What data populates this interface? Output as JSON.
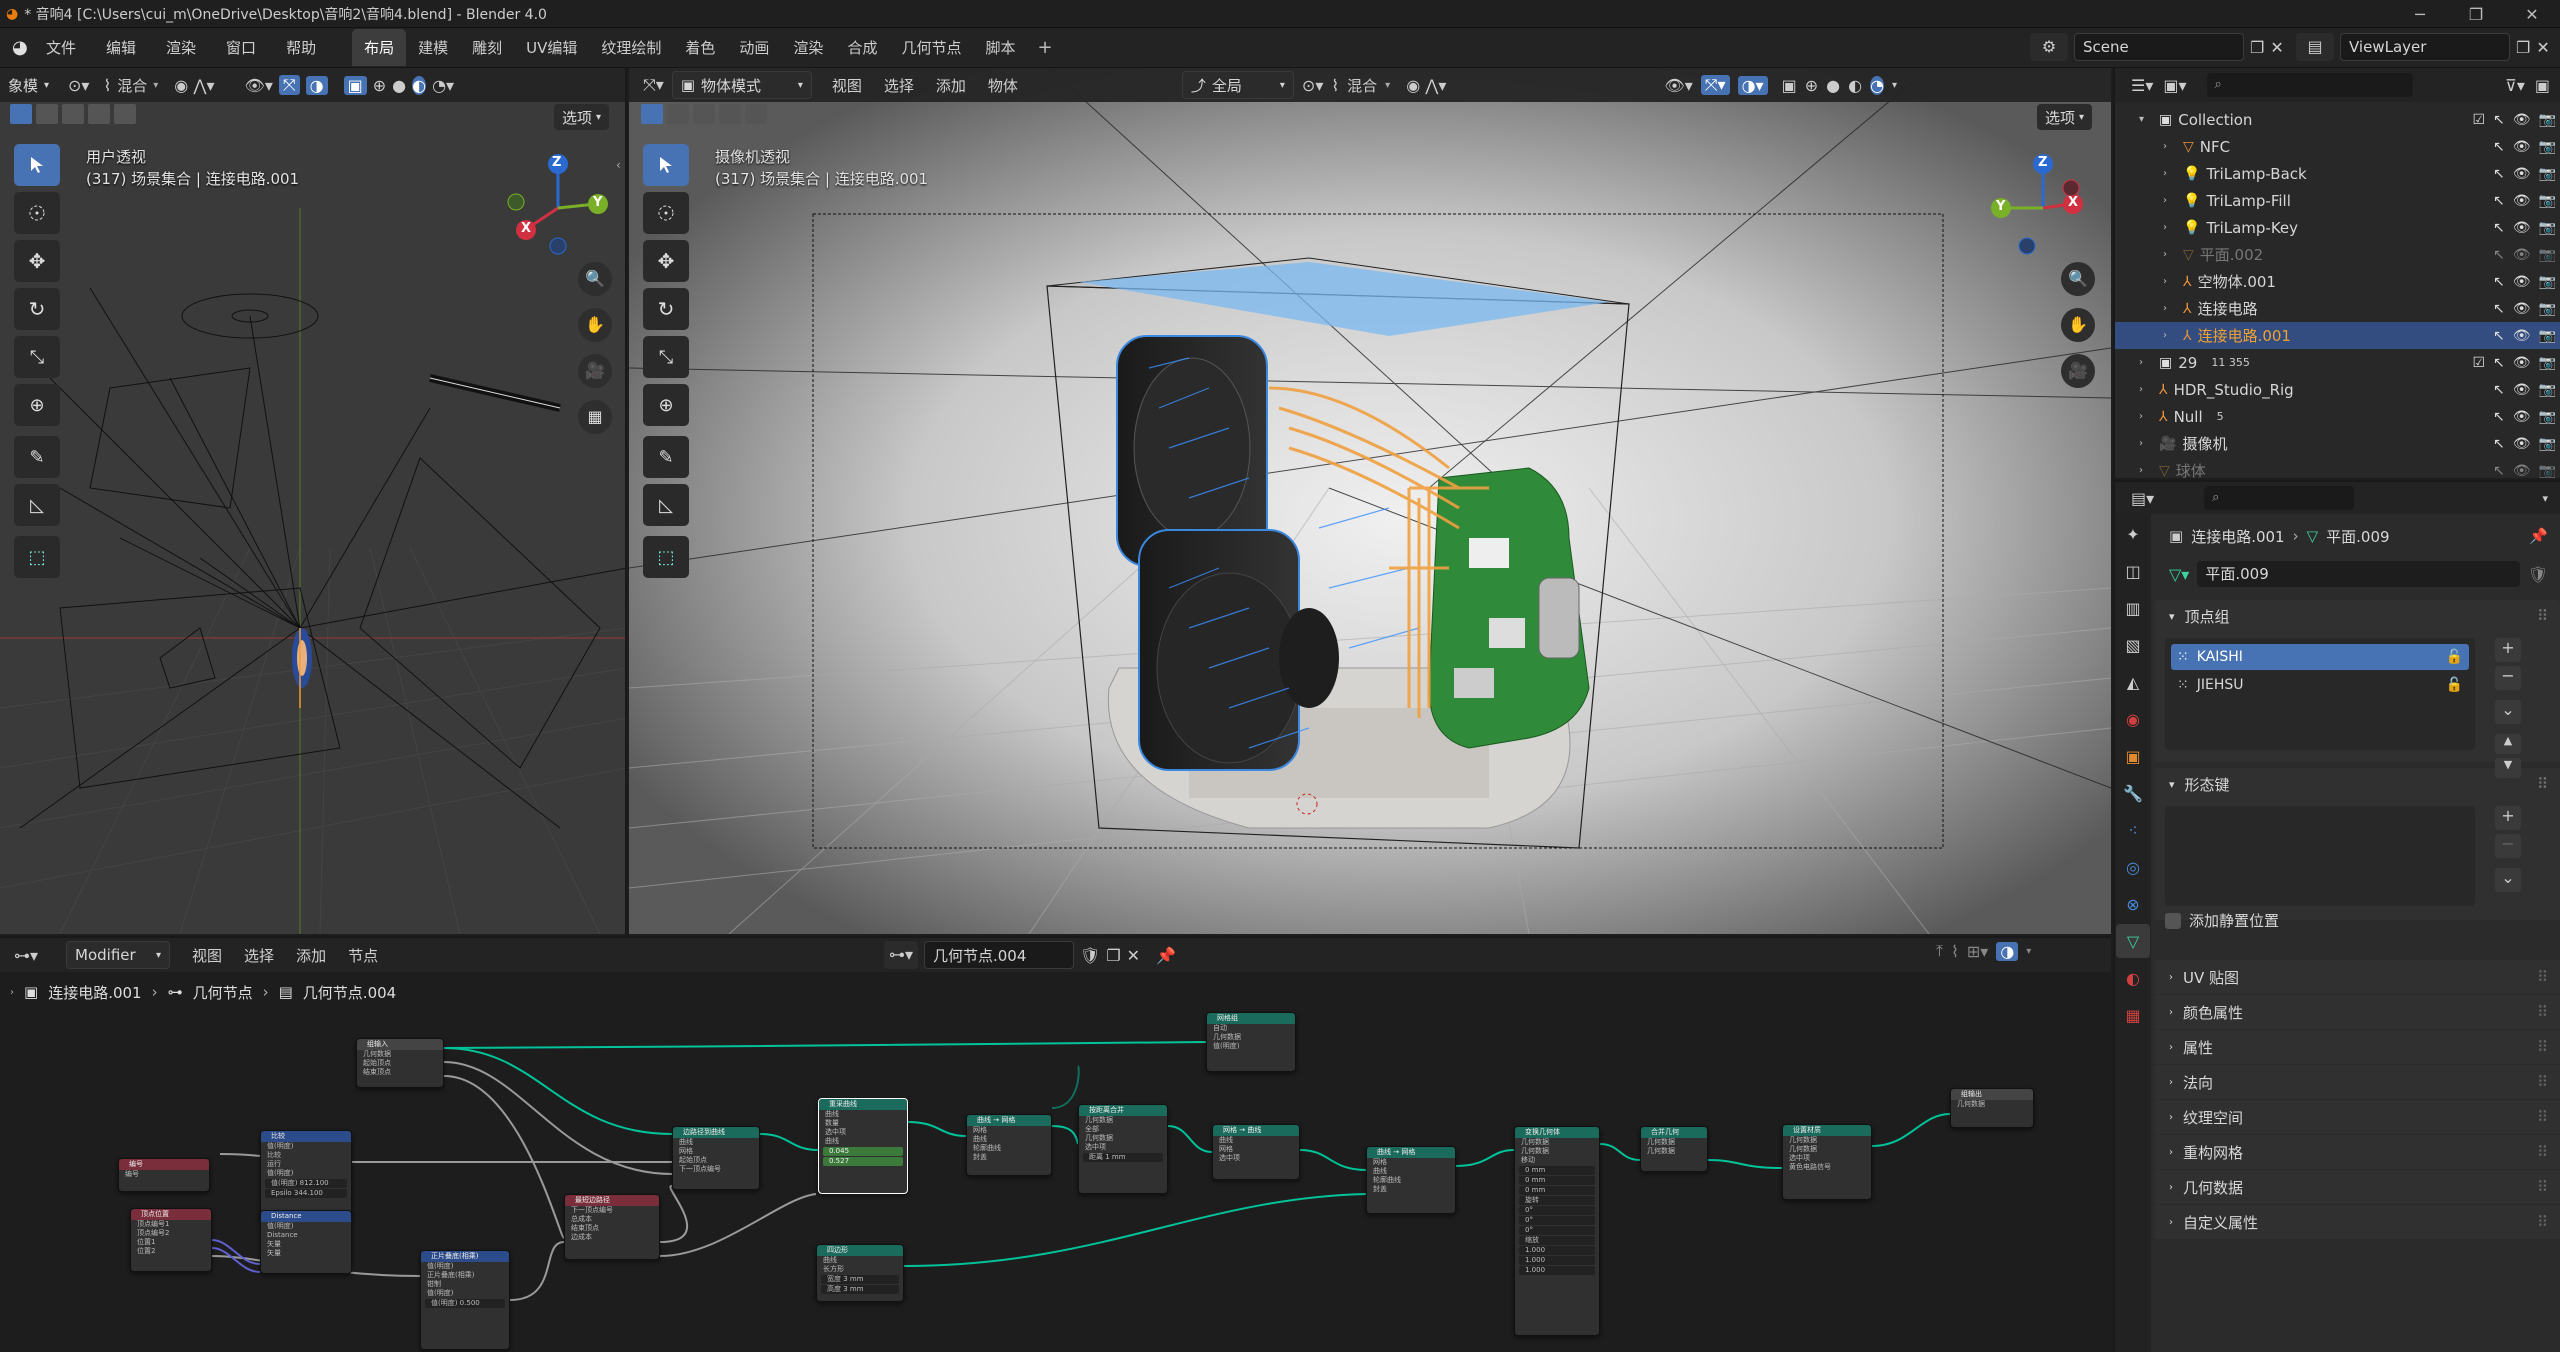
{
  "titlebar": {
    "title": "* 音响4 [C:\\Users\\cui_m\\OneDrive\\Desktop\\音响2\\音响4.blend] - Blender 4.0",
    "min": "─",
    "max": "❐",
    "close": "✕"
  },
  "topbar": {
    "menus": [
      "文件",
      "编辑",
      "渲染",
      "窗口",
      "帮助"
    ],
    "workspaces": [
      "布局",
      "建模",
      "雕刻",
      "UV编辑",
      "纹理绘制",
      "着色",
      "动画",
      "渲染",
      "合成",
      "几何节点",
      "脚本"
    ],
    "active_workspace": "布局",
    "add_tab": "+",
    "scene": "Scene",
    "view_layer": "ViewLayer"
  },
  "left_viewport": {
    "header": {
      "mode": "象模",
      "transform": "混合",
      "options": "选项"
    },
    "overlay_title": "用户透视",
    "overlay_sub": "(317) 场景集合 | 连接电路.001",
    "gizmo": {
      "z": "Z",
      "x": "X",
      "y": "Y"
    }
  },
  "camera_viewport": {
    "header": {
      "mode": "物体模式",
      "menus": [
        "视图",
        "选择",
        "添加",
        "物体"
      ],
      "orientation": "全局",
      "transform": "混合",
      "options": "选项"
    },
    "overlay_title": "摄像机透视",
    "overlay_sub": "(317) 场景集合 | 连接电路.001",
    "gizmo": {
      "z": "Z",
      "x": "X",
      "y": "Y"
    }
  },
  "outliner": {
    "items": [
      {
        "name": "Collection",
        "depth": 0,
        "icon": "collection-icon",
        "checked": true
      },
      {
        "name": "NFC",
        "depth": 1,
        "icon": "mesh-icon"
      },
      {
        "name": "TriLamp-Back",
        "depth": 1,
        "icon": "light-icon"
      },
      {
        "name": "TriLamp-Fill",
        "depth": 1,
        "icon": "light-icon"
      },
      {
        "name": "TriLamp-Key",
        "depth": 1,
        "icon": "light-icon"
      },
      {
        "name": "平面.002",
        "depth": 1,
        "icon": "mesh-icon",
        "dim": true
      },
      {
        "name": "空物体.001",
        "depth": 1,
        "icon": "empty-icon"
      },
      {
        "name": "连接电路",
        "depth": 1,
        "icon": "empty-icon"
      },
      {
        "name": "连接电路.001",
        "depth": 1,
        "icon": "empty-icon",
        "selected": true
      },
      {
        "name": "29",
        "depth": 0,
        "icon": "collection-icon",
        "extra": "11 355",
        "checked": true
      },
      {
        "name": "HDR_Studio_Rig",
        "depth": 0,
        "icon": "empty-icon"
      },
      {
        "name": "Null",
        "depth": 0,
        "icon": "empty-icon",
        "extra": "5"
      },
      {
        "name": "摄像机",
        "depth": 0,
        "icon": "camera-icon"
      },
      {
        "name": "球体",
        "depth": 0,
        "icon": "mesh-icon",
        "dim": true
      }
    ]
  },
  "properties": {
    "breadcrumb_object": "连接电路.001",
    "breadcrumb_data": "平面.009",
    "data_name": "平面.009",
    "vertex_groups_title": "顶点组",
    "vertex_groups": [
      {
        "name": "KAISHI",
        "active": true
      },
      {
        "name": "JIEHSU",
        "active": false
      }
    ],
    "shape_keys_title": "形态键",
    "add_rest_position": "添加静置位置",
    "panels": [
      "UV 贴图",
      "颜色属性",
      "属性",
      "法向",
      "纹理空间",
      "重构网格",
      "几何数据",
      "自定义属性"
    ]
  },
  "node_editor": {
    "header": {
      "editor": "Modifier",
      "menus": [
        "视图",
        "选择",
        "添加",
        "节点"
      ],
      "node_tree": "几何节点.004"
    },
    "breadcrumb": [
      "连接电路.001",
      "几何节点",
      "几何节点.004"
    ],
    "nodes": [
      {
        "id": "group_input",
        "title": "组输入",
        "kind": "grp",
        "rows": [
          "几何数据",
          "起始顶点",
          "结束顶点"
        ]
      },
      {
        "id": "join_geo",
        "title": "网格组",
        "kind": "geo",
        "rows": [
          "自动",
          "几何数据",
          "值(明度)"
        ]
      },
      {
        "id": "index",
        "title": "编号",
        "kind": "inp",
        "rows": [
          "编号"
        ]
      },
      {
        "id": "compare",
        "title": "比较",
        "kind": "conv",
        "rows": [
          "值(明度)",
          "比较",
          "运行",
          "值(明度)",
          "值(明度) 812.100",
          "Epsilo 344.100"
        ]
      },
      {
        "id": "shortest",
        "title": "边路径到曲线",
        "kind": "geo",
        "rows": [
          "曲线",
          "网格",
          "起始顶点",
          "下一顶点编号"
        ]
      },
      {
        "id": "edge_paths",
        "title": "最短边路径",
        "kind": "inp",
        "rows": [
          "下一顶点编号",
          "总成本",
          "结束顶点",
          "边成本"
        ]
      },
      {
        "id": "resample",
        "title": "重采曲线",
        "kind": "geo",
        "rows": [
          "曲线",
          "数量",
          "选中项",
          "曲线",
          "0.045",
          "0.527"
        ]
      },
      {
        "id": "curve_mesh",
        "title": "曲线 → 网格",
        "kind": "geo",
        "rows": [
          "网格",
          "曲线",
          "轮廓曲线",
          "封盖"
        ]
      },
      {
        "id": "merge",
        "title": "按距离合并",
        "kind": "geo",
        "rows": [
          "几何数据",
          "全部",
          "几何数据",
          "选中项",
          "距离 1 mm"
        ]
      },
      {
        "id": "mesh_curve",
        "title": "网格 → 曲线",
        "kind": "geo",
        "rows": [
          "曲线",
          "网格",
          "选中项"
        ]
      },
      {
        "id": "curve_mesh2",
        "title": "曲线 → 网格",
        "kind": "geo",
        "rows": [
          "网格",
          "曲线",
          "轮廓曲线",
          "封盖"
        ]
      },
      {
        "id": "transform",
        "title": "变换几何体",
        "kind": "geo",
        "rows": [
          "几何数据",
          "几何数据",
          "移动",
          "0 mm",
          "0 mm",
          "0 mm",
          "旋转",
          "0°",
          "0°",
          "0°",
          "缩放",
          "1.000",
          "1.000",
          "1.000"
        ]
      },
      {
        "id": "realize",
        "title": "合并几何",
        "kind": "geo",
        "rows": [
          "几何数据",
          "几何数据"
        ]
      },
      {
        "id": "set_material",
        "title": "设置材质",
        "kind": "geo",
        "rows": [
          "几何数据",
          "几何数据",
          "选中项",
          "黄色电路信号"
        ]
      },
      {
        "id": "group_output",
        "title": "组输出",
        "kind": "grp",
        "rows": [
          "几何数据"
        ]
      },
      {
        "id": "vertex_pos",
        "title": "顶点位置",
        "kind": "inp",
        "rows": [
          "顶点编号1",
          "顶点编号2",
          "位置1",
          "位置2"
        ]
      },
      {
        "id": "distance",
        "title": "Distance",
        "kind": "conv",
        "rows": [
          "值(明度)",
          "Distance",
          "矢量",
          "矢量"
        ]
      },
      {
        "id": "float_curve",
        "title": "正片叠底(相乘)",
        "kind": "conv",
        "rows": [
          "值(明度)",
          "正片叠底(相乘)",
          "钳制",
          "值(明度)",
          "值(明度) 0.500"
        ]
      },
      {
        "id": "quad",
        "title": "四边形",
        "kind": "geo",
        "rows": [
          "曲线",
          "长方形",
          "宽度 3 mm",
          "高度 3 mm"
        ]
      }
    ]
  },
  "colors": {
    "accent": "#4772b3",
    "selection_text": "#f0a030",
    "geo_header": "#1b6b5c",
    "socket_geo": "#00d6a3"
  }
}
